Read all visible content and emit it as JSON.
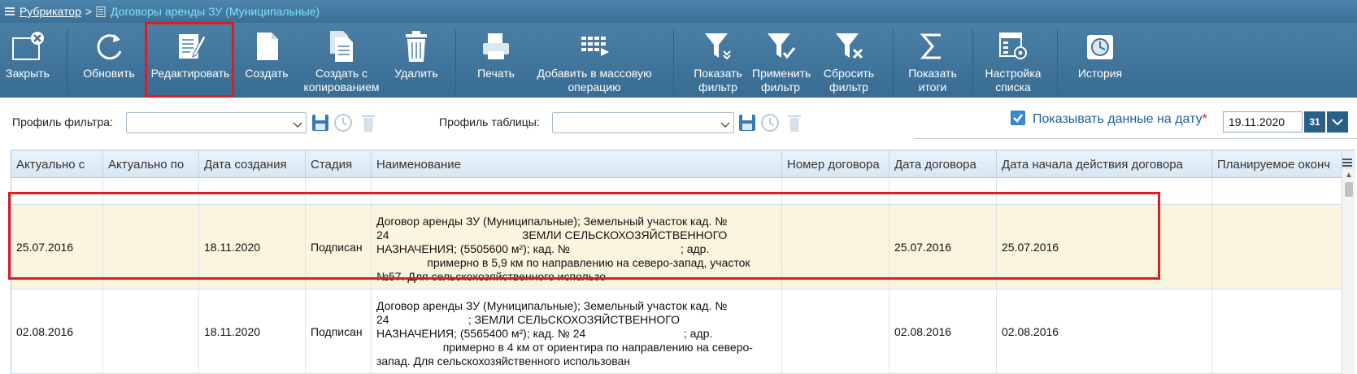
{
  "breadcrumb": {
    "root": "Рубрикатор",
    "separator": ">",
    "current": "Договоры аренды ЗУ (Муниципальные)"
  },
  "toolbar": {
    "close": "Закрыть",
    "refresh": "Обновить",
    "edit": "Редактировать",
    "create": "Создать",
    "create_copy": "Создать с копированием",
    "delete": "Удалить",
    "print": "Печать",
    "add_mass": "Добавить в массовую операцию",
    "show_filter": "Показать фильтр",
    "apply_filter": "Применить фильтр",
    "reset_filter": "Сбросить фильтр",
    "show_totals": "Показать итоги",
    "list_settings": "Настройка списка",
    "history": "История"
  },
  "filters": {
    "filter_profile_label": "Профиль фильтра:",
    "filter_profile_value": "",
    "table_profile_label": "Профиль таблицы:",
    "table_profile_value": "",
    "show_on_date_label": "Показывать данные на дату",
    "required_mark": "*",
    "date_value": "19.11.2020",
    "calendar_label": "31"
  },
  "table": {
    "columns": [
      "Актуально с",
      "Актуально по",
      "Дата создания",
      "Стадия",
      "Наименование",
      "Номер договора",
      "Дата договора",
      "Дата начала действия договора",
      "Планируемое оконч"
    ],
    "rows": [
      {
        "c0": "",
        "c1": "",
        "c2": "",
        "c3": "",
        "c4": "",
        "c5": "",
        "c6": "",
        "c7": "",
        "c8": ""
      },
      {
        "c0": "25.07.2016",
        "c1": "",
        "c2": "18.11.2020",
        "c3": "Подписан",
        "c4": "Договор аренды ЗУ (Муниципальные); Земельный участок кад. №\n24                                          ЗЕМЛИ СЕЛЬСКОХОЗЯЙСТВЕННОГО\nНАЗНАЧЕНИЯ; (5505600 м²); кад. №                                   ; адр.\n                примерно в 5,9 км по направлению на северо-запад, участок\n№57. Для сельскохозяйственного использо",
        "c5": "",
        "c6": "25.07.2016",
        "c7": "25.07.2016",
        "c8": ""
      },
      {
        "c0": "02.08.2016",
        "c1": "",
        "c2": "18.11.2020",
        "c3": "Подписан",
        "c4": "Договор аренды ЗУ (Муниципальные); Земельный участок кад. №\n24                         ; ЗЕМЛИ СЕЛЬСКОХОЗЯЙСТВЕННОГО\nНАЗНАЧЕНИЯ; (5565400 м²); кад. № 24                               ; адр.\n                     примерно в 4 км от ориентира по направлению на северо-\nзапад. Для сельскохозяйственного использован",
        "c5": "",
        "c6": "02.08.2016",
        "c7": "02.08.2016",
        "c8": ""
      }
    ]
  },
  "colors": {
    "toolbar": "#3f739b",
    "highlight": "#e01b24",
    "selected_row": "#fbf5df",
    "accent_link": "#1f5f9f"
  },
  "icons": [
    "list-icon",
    "document-icon",
    "close-icon",
    "refresh-icon",
    "edit-icon",
    "new-document-icon",
    "copy-document-icon",
    "trash-icon",
    "printer-icon",
    "mass-operation-icon",
    "filter-show-icon",
    "filter-apply-icon",
    "filter-reset-icon",
    "sigma-icon",
    "settings-list-icon",
    "history-icon",
    "save-icon",
    "clock-icon",
    "checkbox-icon",
    "calendar-icon",
    "chevron-down-icon"
  ]
}
